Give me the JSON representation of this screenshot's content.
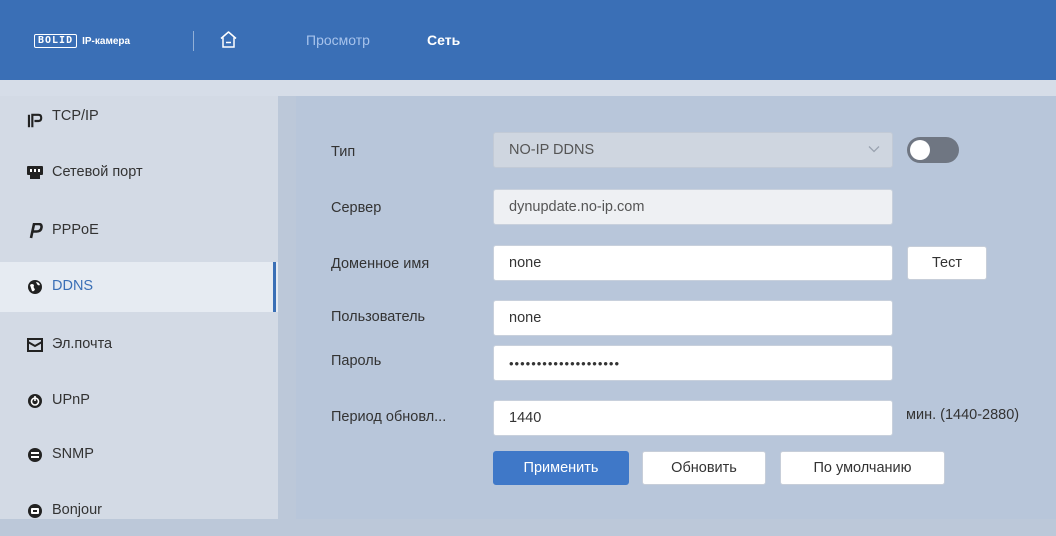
{
  "header": {
    "logo_text": "BOLID",
    "logo_sub": "IP-камера",
    "tabs": [
      {
        "label": "Просмотр",
        "active": false
      },
      {
        "label": "Сеть",
        "active": true
      }
    ]
  },
  "sidebar": {
    "items": [
      {
        "label": "TCP/IP",
        "icon": "ip-icon"
      },
      {
        "label": "Сетевой порт",
        "icon": "network-port-icon"
      },
      {
        "label": "PPPoE",
        "icon": "pppoe-icon"
      },
      {
        "label": "DDNS",
        "icon": "globe-icon",
        "active": true
      },
      {
        "label": "Эл.почта",
        "icon": "mail-icon"
      },
      {
        "label": "UPnP",
        "icon": "upnp-icon"
      },
      {
        "label": "SNMP",
        "icon": "snmp-icon"
      },
      {
        "label": "Bonjour",
        "icon": "bonjour-icon"
      }
    ]
  },
  "form": {
    "type_label": "Тип",
    "type_value": "NO-IP DDNS",
    "enabled": false,
    "server_label": "Сервер",
    "server_value": "dynupdate.no-ip.com",
    "domain_label": "Доменное имя",
    "domain_value": "none",
    "test_label": "Тест",
    "user_label": "Пользователь",
    "user_value": "none",
    "password_label": "Пароль",
    "password_value": "••••••••••••••••••••",
    "period_label": "Период обновл...",
    "period_value": "1440",
    "period_unit": "мин. (1440-2880)"
  },
  "buttons": {
    "apply": "Применить",
    "refresh": "Обновить",
    "default": "По умолчанию"
  },
  "colors": {
    "header": "#3a6fb6",
    "accent": "#3f78c8",
    "sidebar": "#d3dae5",
    "panel": "#b8c6da"
  }
}
